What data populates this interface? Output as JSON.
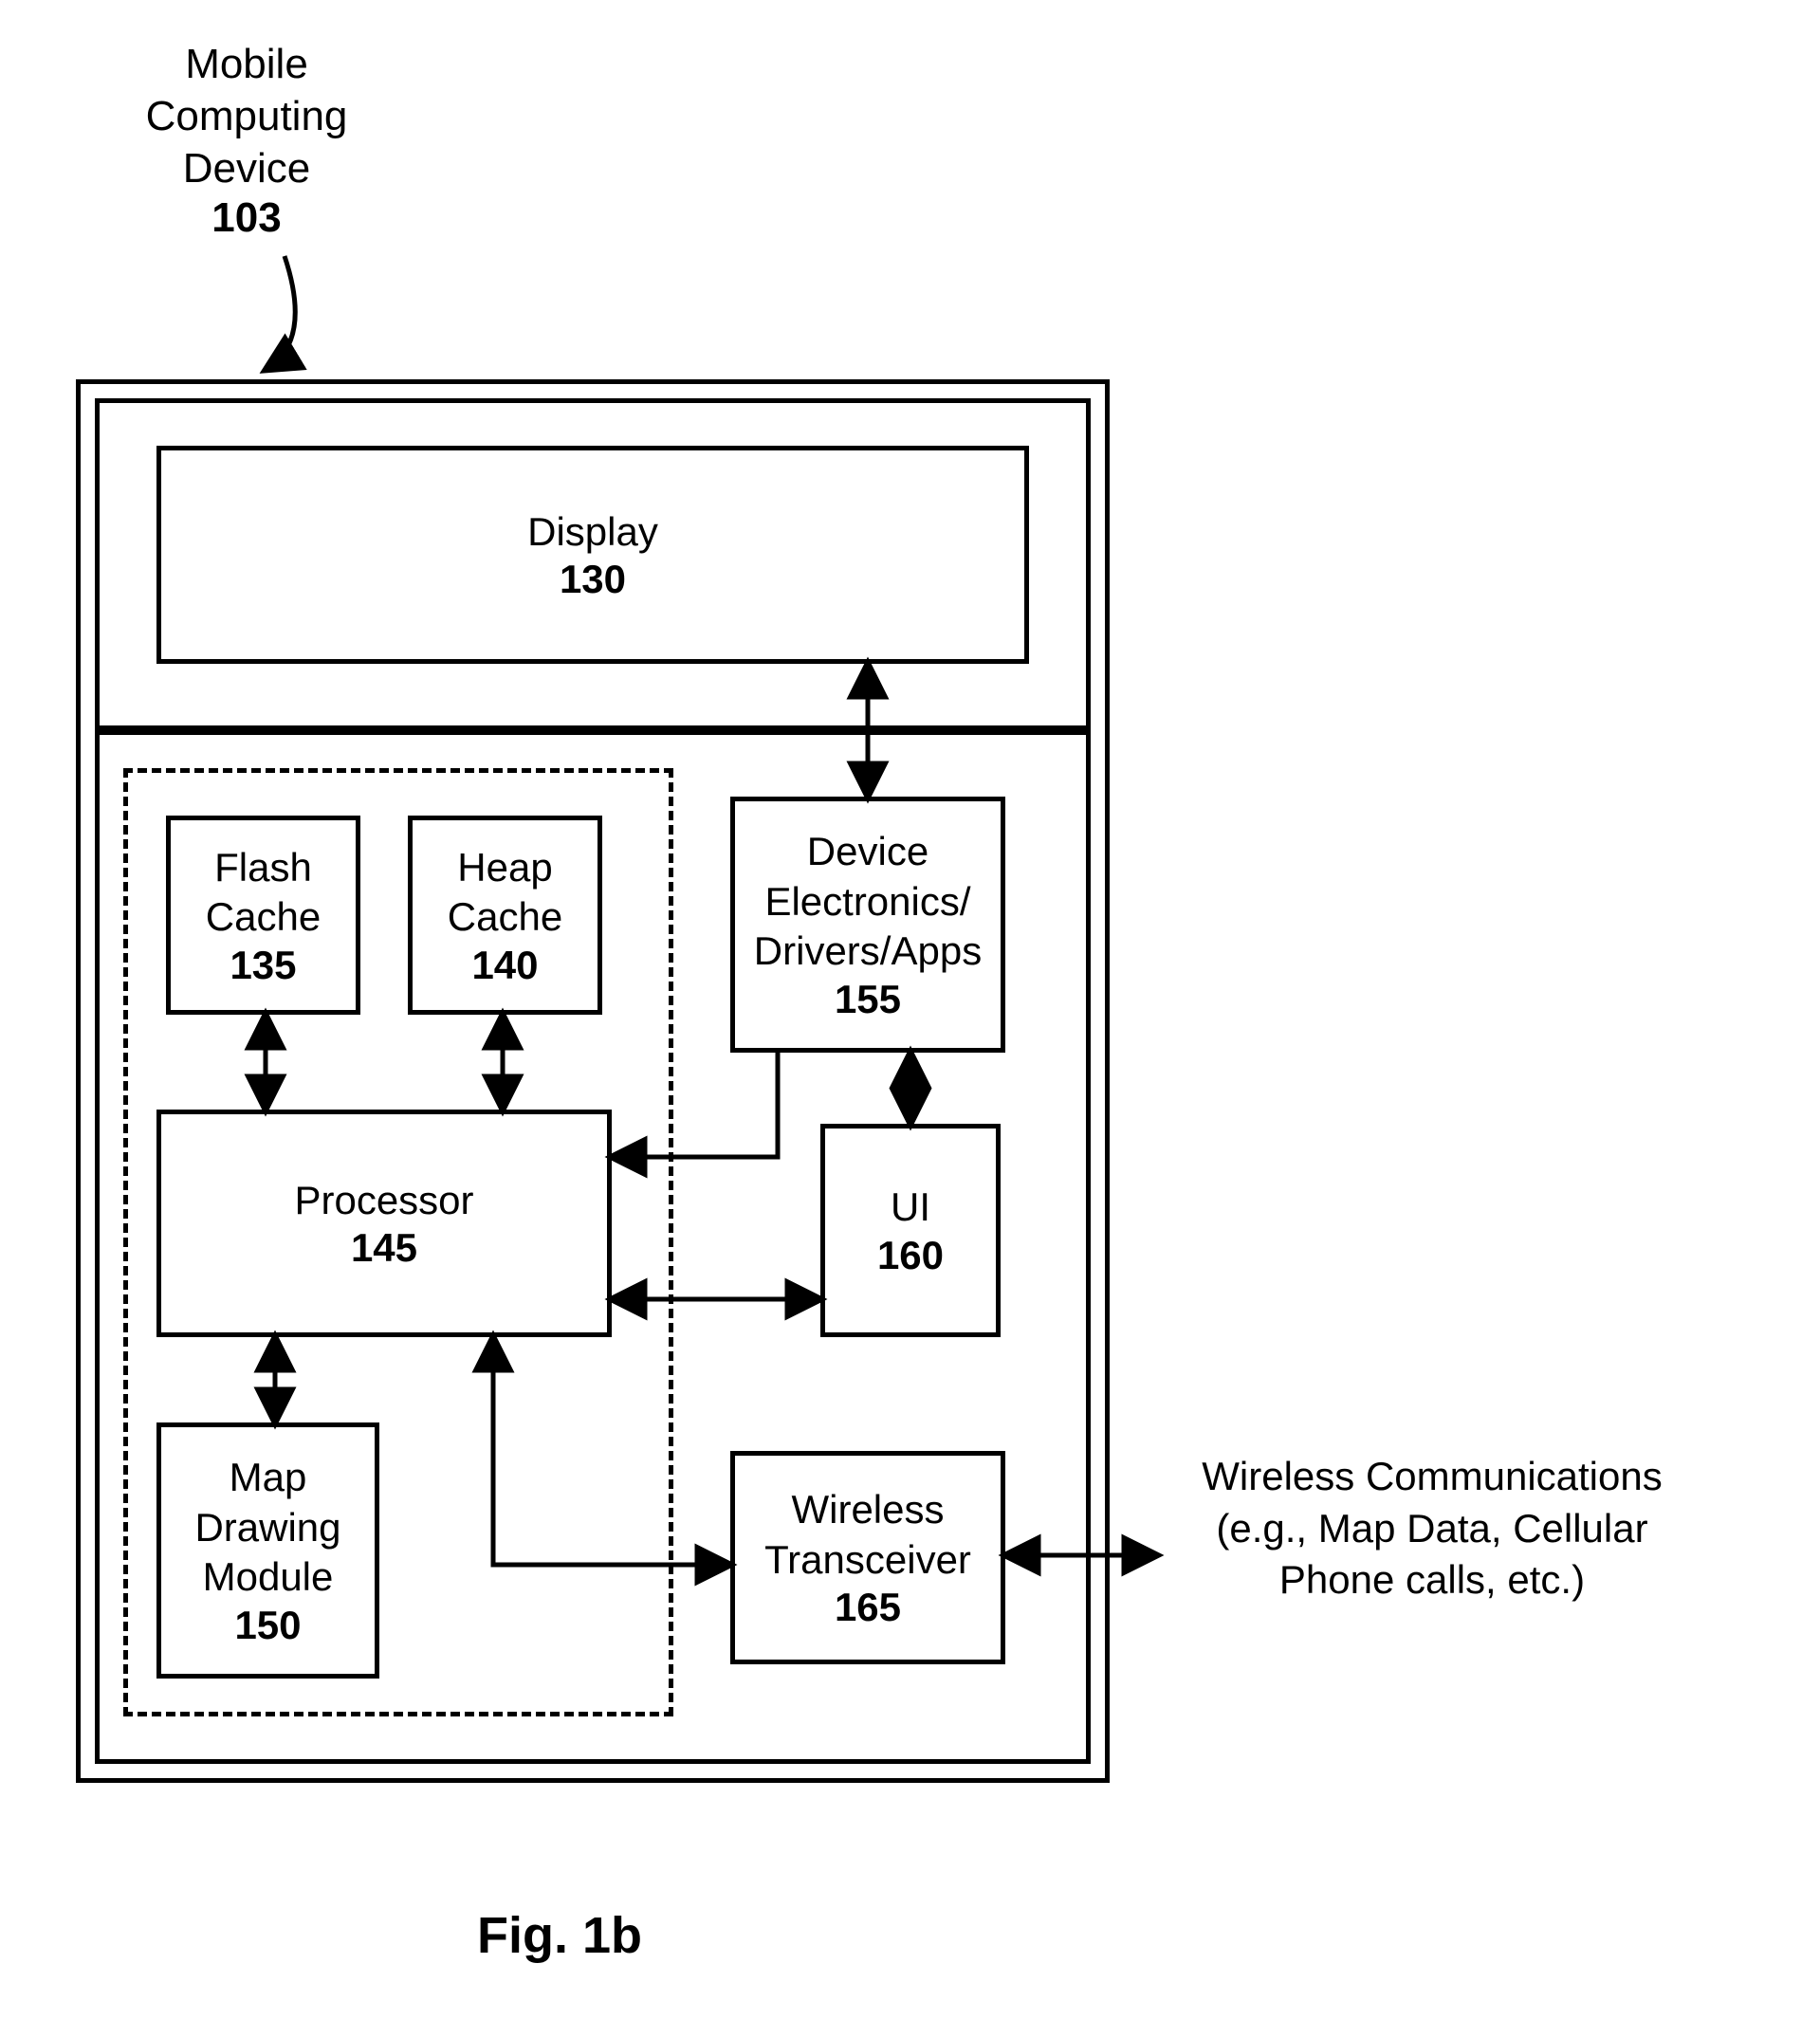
{
  "title": {
    "label": "Mobile Computing Device",
    "ref": "103"
  },
  "figure": {
    "label": "Fig. 1b"
  },
  "blocks": {
    "display": {
      "label": "Display",
      "ref": "130"
    },
    "flash": {
      "label": "Flash Cache",
      "ref": "135"
    },
    "heap": {
      "label": "Heap Cache",
      "ref": "140"
    },
    "processor": {
      "label": "Processor",
      "ref": "145"
    },
    "map": {
      "label": "Map Drawing Module",
      "ref": "150"
    },
    "device": {
      "label": "Device Electronics/ Drivers/Apps",
      "ref": "155"
    },
    "ui": {
      "label": "UI",
      "ref": "160"
    },
    "transceiver": {
      "label": "Wireless Transceiver",
      "ref": "165"
    }
  },
  "side": {
    "label": "Wireless Communications (e.g., Map Data, Cellular Phone calls, etc.)"
  }
}
